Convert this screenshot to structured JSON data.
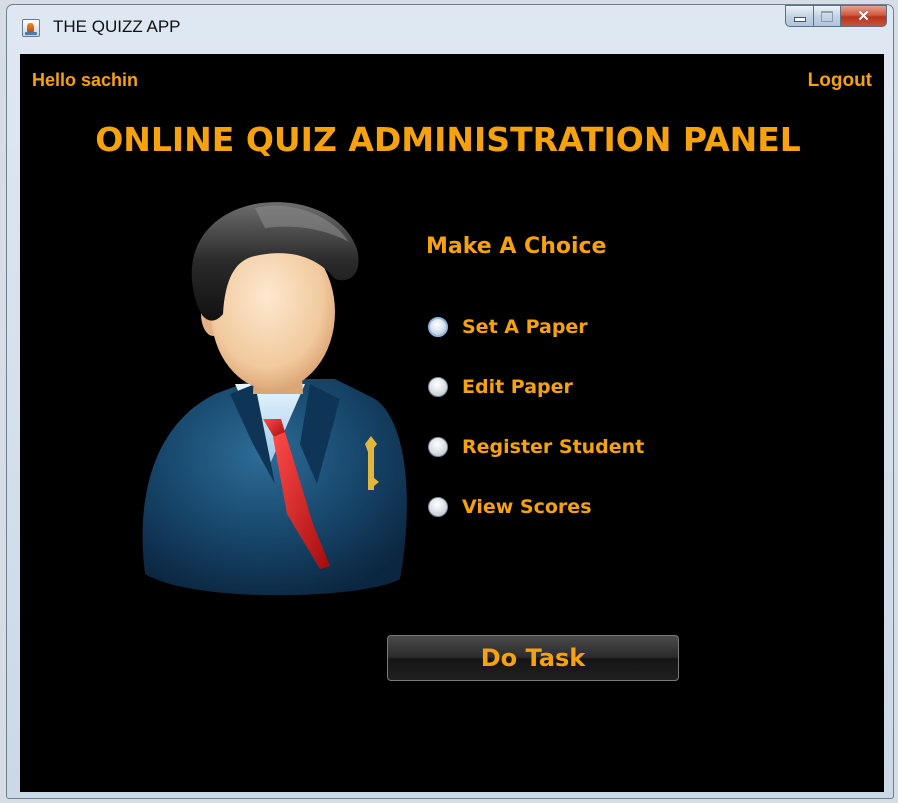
{
  "window": {
    "title": "THE QUIZZ APP",
    "controls": {
      "minimize": "minimize",
      "maximize": "maximize",
      "close": "close"
    }
  },
  "header": {
    "greeting": "Hello sachin",
    "logout_label": "Logout",
    "title": "ONLINE QUIZ ADMINISTRATION PANEL"
  },
  "choices": {
    "heading": "Make A Choice",
    "options": [
      {
        "label": "Set A Paper",
        "selected": false
      },
      {
        "label": "Edit Paper",
        "selected": false
      },
      {
        "label": "Register Student",
        "selected": false
      },
      {
        "label": "View Scores",
        "selected": false
      }
    ]
  },
  "actions": {
    "do_task_label": "Do Task"
  },
  "icons": {
    "app_icon": "java-cup-icon",
    "avatar": "businessman-avatar-icon"
  },
  "colors": {
    "accent": "#f5a20c",
    "background": "#000000"
  }
}
